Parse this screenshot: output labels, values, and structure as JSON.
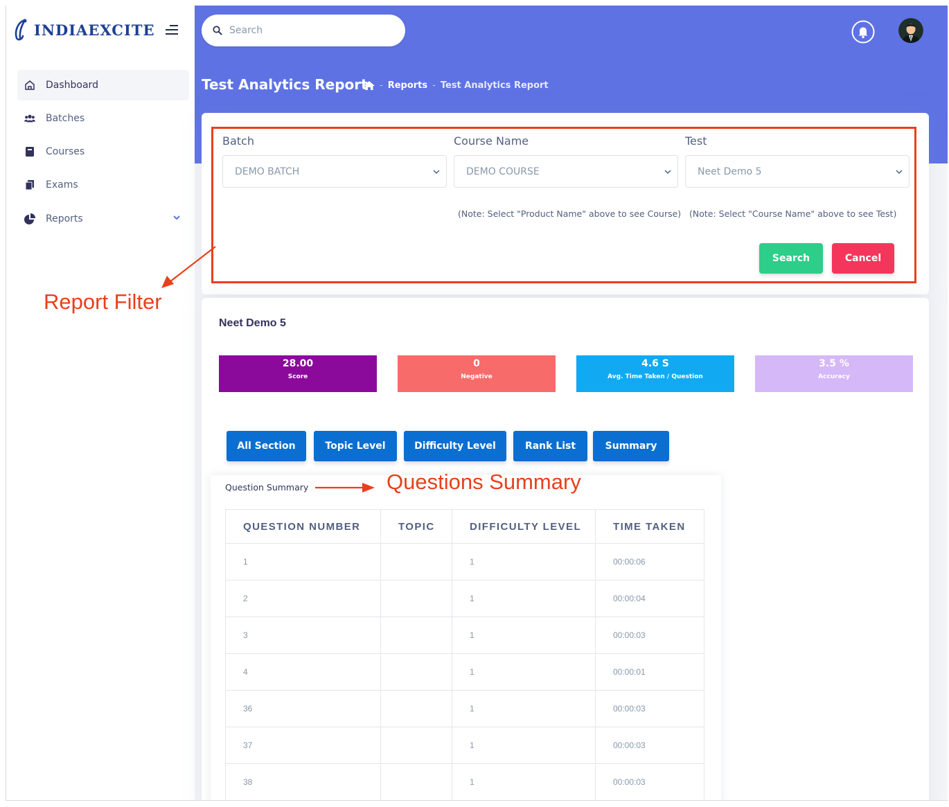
{
  "brand": {
    "name": "INDIAEXCITE"
  },
  "sidebar": {
    "items": [
      {
        "label": "Dashboard",
        "icon": "house-icon",
        "active": true
      },
      {
        "label": "Batches",
        "icon": "users-icon"
      },
      {
        "label": "Courses",
        "icon": "book-icon"
      },
      {
        "label": "Exams",
        "icon": "copy-icon"
      },
      {
        "label": "Reports",
        "icon": "pie-chart-icon",
        "has_submenu": true
      }
    ]
  },
  "header": {
    "search_placeholder": "Search",
    "page_title": "Test Analytics Report",
    "breadcrumb": {
      "home_icon": "home-icon",
      "items": [
        "Reports",
        "Test Analytics Report"
      ],
      "separator": "-"
    }
  },
  "filter": {
    "batch": {
      "label": "Batch",
      "value": "DEMO BATCH"
    },
    "course": {
      "label": "Course Name",
      "value": "DEMO COURSE",
      "note": "(Note: Select \"Product Name\" above to see Course)"
    },
    "test": {
      "label": "Test",
      "value": "Neet Demo 5",
      "note": "(Note: Select \"Course Name\" above to see Test)"
    },
    "search_label": "Search",
    "cancel_label": "Cancel"
  },
  "annotations": {
    "report_filter": "Report Filter",
    "questions_summary": "Questions Summary"
  },
  "report": {
    "test_name": "Neet Demo 5",
    "stats": [
      {
        "value": "28.00",
        "label": "Score",
        "color": "#8b0a9c"
      },
      {
        "value": "0",
        "label": "Negative",
        "color": "#f86b6b"
      },
      {
        "value": "4.6 S",
        "label": "Avg. Time Taken / Question",
        "color": "#11aaf2"
      },
      {
        "value": "3.5 %",
        "label": "Accuracy",
        "color": "#d5b8f7"
      }
    ],
    "tabs": [
      "All Section",
      "Topic Level",
      "Difficulty Level",
      "Rank List",
      "Summary"
    ],
    "summary_label": "Question Summary",
    "table": {
      "headers": [
        "QUESTION NUMBER",
        "TOPIC",
        "DIFFICULTY LEVEL",
        "TIME TAKEN"
      ],
      "rows": [
        [
          "1",
          "",
          "1",
          "00:00:06"
        ],
        [
          "2",
          "",
          "1",
          "00:00:04"
        ],
        [
          "3",
          "",
          "1",
          "00:00:03"
        ],
        [
          "4",
          "",
          "1",
          "00:00:01"
        ],
        [
          "36",
          "",
          "1",
          "00:00:03"
        ],
        [
          "37",
          "",
          "1",
          "00:00:03"
        ],
        [
          "38",
          "",
          "1",
          "00:00:03"
        ]
      ]
    }
  },
  "colors": {
    "primary": "#5e72e4",
    "success": "#2dce89",
    "danger": "#f5365c",
    "tab_blue": "#0b6fd1",
    "annotation": "#e8401c"
  }
}
